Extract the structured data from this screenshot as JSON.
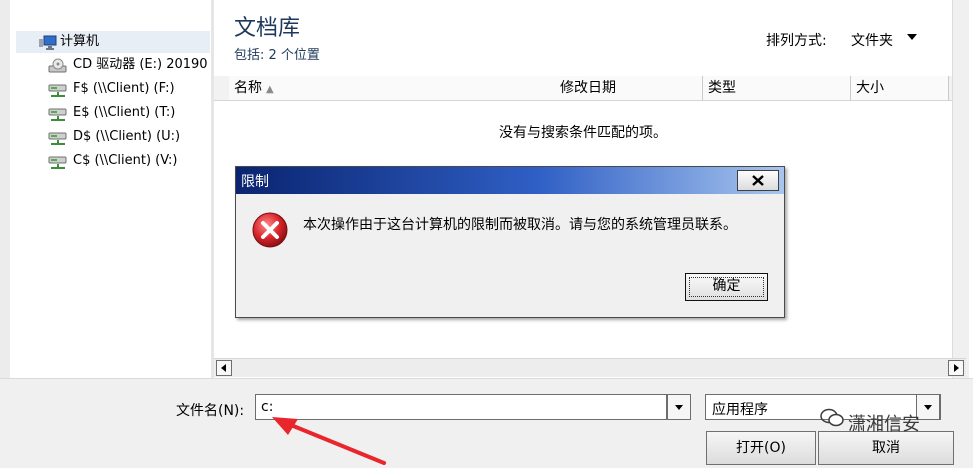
{
  "nav": {
    "items": [
      {
        "label": "计算机",
        "icon": "computer-icon"
      },
      {
        "label": "CD 驱动器 (E:) 20190",
        "icon": "cd-drive-icon"
      },
      {
        "label": "F$ (\\\\Client) (F:)",
        "icon": "network-drive-icon"
      },
      {
        "label": "E$ (\\\\Client) (T:)",
        "icon": "network-drive-icon"
      },
      {
        "label": "D$ (\\\\Client) (U:)",
        "icon": "network-drive-icon"
      },
      {
        "label": "C$ (\\\\Client) (V:)",
        "icon": "network-drive-icon"
      }
    ]
  },
  "library": {
    "title": "文档库",
    "subtitle": "包括: 2 个位置",
    "sort_label": "排列方式:",
    "sort_value": "文件夹"
  },
  "columns": [
    "名称",
    "修改日期",
    "类型",
    "大小"
  ],
  "empty_message": "没有与搜索条件匹配的项。",
  "bottom": {
    "filename_label": "文件名(N):",
    "filename_value": "c:",
    "filetype_value": "应用程序",
    "open_label": "打开(O)",
    "cancel_label": "取消"
  },
  "dialog": {
    "title": "限制",
    "message": "本次操作由于这台计算机的限制而被取消。请与您的系统管理员联系。",
    "ok_label": "确定",
    "close_glyph": "✕"
  },
  "watermark": "潇湘信安",
  "colors": {
    "title_bar_start": "#0a2470",
    "title_bar_end": "#a8c6ee",
    "error_red": "#d8262c",
    "annotation_red": "#e8262b",
    "heading_blue": "#1e395b"
  }
}
